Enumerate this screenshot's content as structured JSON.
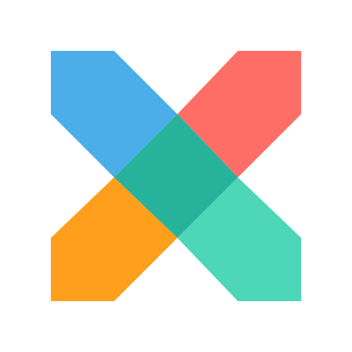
{
  "logo": {
    "icon": "x-logo-icon",
    "colors": {
      "top_left": "#4BAEE8",
      "top_right": "#FF6E66",
      "bottom_left": "#FF9F1C",
      "bottom_right": "#4DD6B8",
      "center": "#27B39B"
    }
  }
}
